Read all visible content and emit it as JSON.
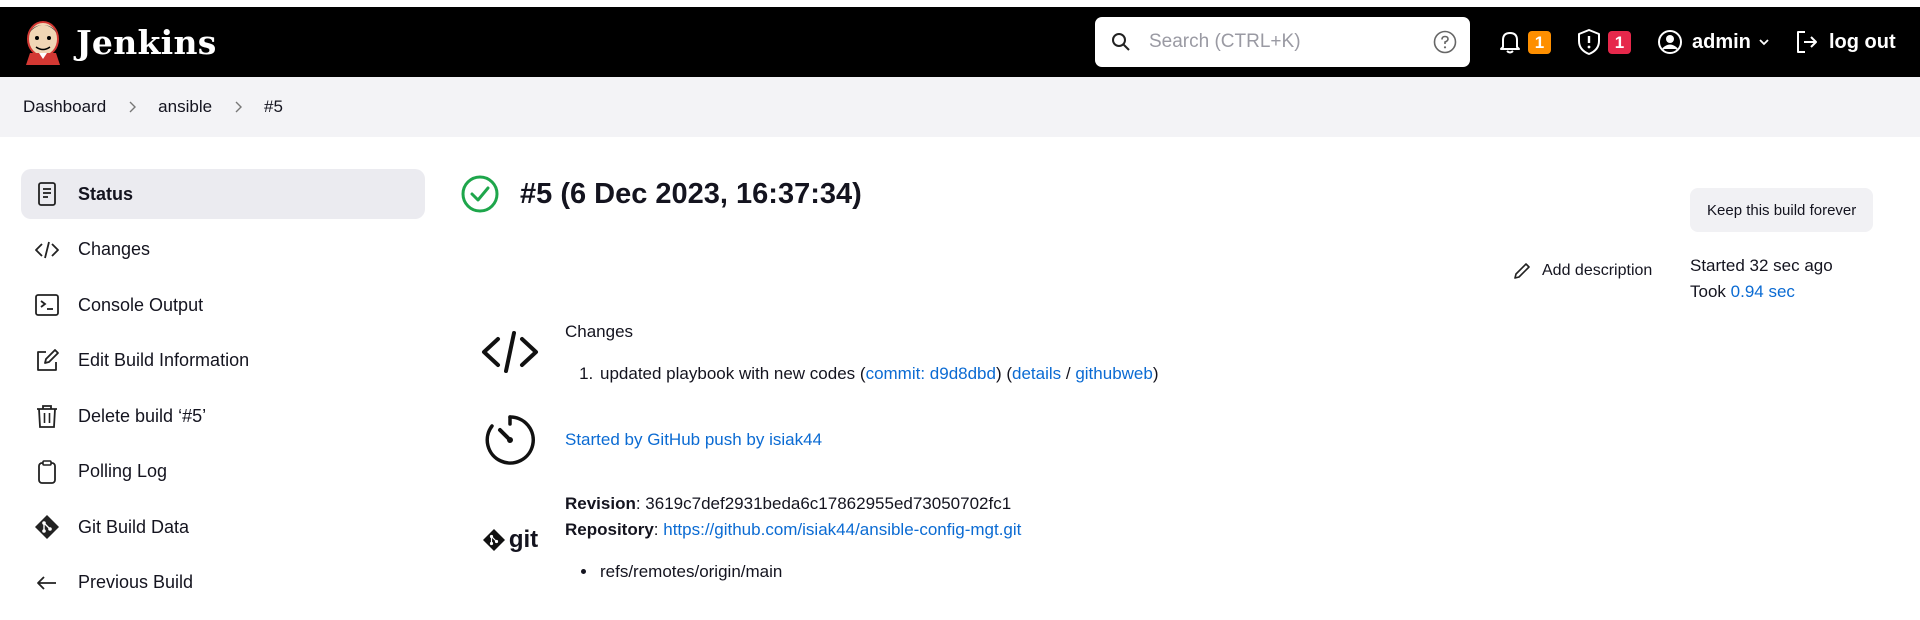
{
  "header": {
    "brand": "Jenkins",
    "search_placeholder": "Search (CTRL+K)",
    "notifications_count": "1",
    "security_count": "1",
    "user": "admin",
    "logout": "log out",
    "colors": {
      "bar": "#000000",
      "notify_badge": "#fe8f00",
      "security_badge": "#e6284b"
    }
  },
  "breadcrumb": [
    "Dashboard",
    "ansible",
    "#5"
  ],
  "sidebar": {
    "items": [
      {
        "label": "Status",
        "icon": "document-icon",
        "active": true
      },
      {
        "label": "Changes",
        "icon": "code-icon"
      },
      {
        "label": "Console Output",
        "icon": "terminal-icon"
      },
      {
        "label": "Edit Build Information",
        "icon": "edit-icon"
      },
      {
        "label": "Delete build ‘#5’",
        "icon": "trash-icon"
      },
      {
        "label": "Polling Log",
        "icon": "clipboard-icon"
      },
      {
        "label": "Git Build Data",
        "icon": "git-icon"
      },
      {
        "label": "Previous Build",
        "icon": "arrow-left-icon"
      }
    ]
  },
  "build": {
    "title": "#5 (6 Dec 2023, 16:37:34)",
    "status_color": "#1ea64b",
    "keep_forever": "Keep this build forever",
    "add_description": "Add description",
    "started": "Started 32 sec ago",
    "took_prefix": "Took ",
    "took_value": "0.94 sec"
  },
  "changes": {
    "heading": "Changes",
    "item_text": "updated playbook with new codes (",
    "commit_link": "commit: d9d8dbd",
    "mid": ") (",
    "details_link": "details",
    "slash": " / ",
    "githubweb_link": "githubweb",
    "end": ")"
  },
  "trigger": {
    "text": "Started by GitHub push by isiak44"
  },
  "git": {
    "logo_text": "git",
    "revision_label": "Revision",
    "revision_value": ": 3619c7def2931beda6c17862955ed73050702fc1",
    "repository_label": "Repository",
    "repository_sep": ": ",
    "repository_url": "https://github.com/isiak44/ansible-config-mgt.git",
    "branch": "refs/remotes/origin/main"
  }
}
